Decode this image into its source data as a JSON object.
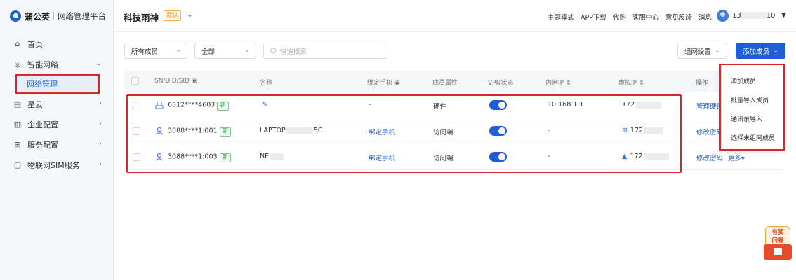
{
  "brand": {
    "name": "蒲公英",
    "sub": "网络管理平台"
  },
  "sidebar": {
    "items": [
      {
        "label": "首页",
        "icon": "home-icon",
        "glyph": "⌂"
      },
      {
        "label": "智能网络",
        "icon": "network-icon",
        "glyph": "◎",
        "chevron": "⌄"
      },
      {
        "label": "星云",
        "icon": "cloud-icon",
        "glyph": "▤",
        "chevron": "›"
      },
      {
        "label": "企业配置",
        "icon": "enterprise-icon",
        "glyph": "▥",
        "chevron": "›"
      },
      {
        "label": "服务配置",
        "icon": "service-icon",
        "glyph": "⊞",
        "chevron": "›"
      },
      {
        "label": "物联网SIM服务",
        "icon": "sim-icon",
        "glyph": "▢",
        "chevron": "›"
      }
    ],
    "active_sub": "网络管理"
  },
  "header": {
    "org_name": "科技雨神",
    "org_tag": "默认",
    "links": [
      "主题模式",
      "APP下载",
      "代购",
      "客服中心",
      "意见反馈",
      "消息"
    ],
    "user_prefix": "13",
    "user_suffix": "10"
  },
  "filters": {
    "member_select": "所有成员",
    "scope_select": "全部",
    "search_placeholder": "快速搜索"
  },
  "actions": {
    "group_settings": "组网设置",
    "add_member": "添加成员"
  },
  "table": {
    "headers": [
      "SN/UID/SID",
      "名称",
      "绑定手机",
      "成员属性",
      "VPN状态",
      "内网IP",
      "虚拟IP",
      "操作"
    ],
    "rows": [
      {
        "id": "6312****4603",
        "badge": "新",
        "name": "",
        "phone": "-",
        "attr": "硬件",
        "vpn": true,
        "lan_ip": "10.168.1.1",
        "vip": "172",
        "op": "管理硬件",
        "op2": ""
      },
      {
        "id": "3088****1:001",
        "badge": "新",
        "name": "LAPTOP",
        "name_suffix": "5C",
        "phone": "绑定手机",
        "attr": "访问端",
        "vpn": true,
        "lan_ip": "-",
        "vip": "172",
        "op": "修改密码",
        "op2": ""
      },
      {
        "id": "3088****1:003",
        "badge": "新",
        "name": "NE",
        "name_suffix": "",
        "phone": "绑定手机",
        "attr": "访问端",
        "vpn": true,
        "lan_ip": "-",
        "vip": "172",
        "op": "修改密码",
        "op2": "更多▾"
      }
    ]
  },
  "dropdown": {
    "items": [
      "添加成员",
      "批量导入成员",
      "通讯录导入",
      "选择未组网成员"
    ]
  },
  "promo": {
    "line1": "有奖",
    "line2": "问卷"
  },
  "colors": {
    "primary": "#1f5fd6",
    "highlight": "#d9262b",
    "new_badge": "#29a745"
  }
}
